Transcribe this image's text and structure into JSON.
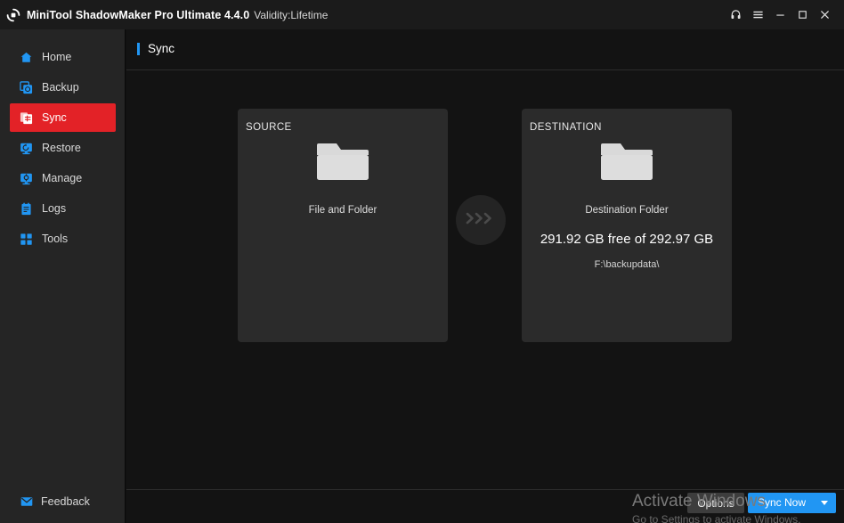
{
  "titlebar": {
    "app_icon": "sync-logo-icon",
    "title": "MiniTool ShadowMaker Pro Ultimate 4.4.0",
    "validity": "Validity:Lifetime",
    "buttons": [
      {
        "name": "support-icon",
        "label": ""
      },
      {
        "name": "menu-icon",
        "label": ""
      },
      {
        "name": "minimize-icon",
        "label": ""
      },
      {
        "name": "maximize-icon",
        "label": ""
      },
      {
        "name": "close-icon",
        "label": ""
      }
    ]
  },
  "sidebar": {
    "items": [
      {
        "label": "Home",
        "icon": "home-icon",
        "active": false
      },
      {
        "label": "Backup",
        "icon": "backup-icon",
        "active": false
      },
      {
        "label": "Sync",
        "icon": "sync-icon",
        "active": true
      },
      {
        "label": "Restore",
        "icon": "restore-icon",
        "active": false
      },
      {
        "label": "Manage",
        "icon": "manage-icon",
        "active": false
      },
      {
        "label": "Logs",
        "icon": "logs-icon",
        "active": false
      },
      {
        "label": "Tools",
        "icon": "tools-icon",
        "active": false
      }
    ],
    "feedback": {
      "label": "Feedback",
      "icon": "mail-icon"
    }
  },
  "page": {
    "title": "Sync",
    "accent_color": "#2196f3"
  },
  "source_card": {
    "label": "SOURCE",
    "icon": "folder-icon",
    "caption": "File and Folder"
  },
  "destination_card": {
    "label": "DESTINATION",
    "icon": "folder-icon",
    "caption": "Destination Folder",
    "capacity": "291.92 GB free of 292.97 GB",
    "path": "F:\\backupdata\\"
  },
  "transfer_arrow": {
    "icon": "chevrons-right-icon"
  },
  "bottom_bar": {
    "options_label": "Options",
    "sync_now_label": "Sync Now",
    "sync_now_color": "#2196f3",
    "dropdown_icon": "caret-down-icon"
  },
  "watermark": {
    "title": "Activate Windows",
    "subtitle": "Go to Settings to activate Windows."
  },
  "colors": {
    "accent_blue": "#2196f3",
    "active_red": "#e32227",
    "card_bg": "#2b2b2b",
    "sidebar_bg": "#252525",
    "main_bg": "#131313",
    "titlebar_bg": "#1b1b1b"
  }
}
